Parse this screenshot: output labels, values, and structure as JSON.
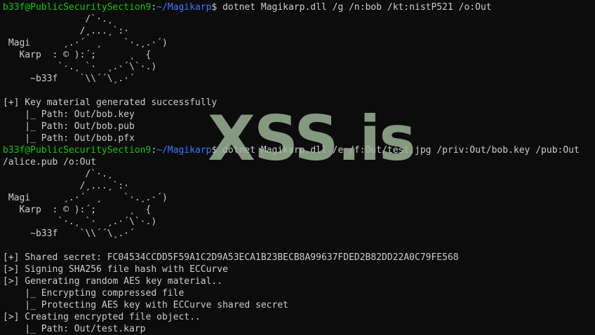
{
  "prompt": {
    "user_host": "b33f@PublicSecuritySection9",
    "separator": ":",
    "cwd": "~/Magikarp",
    "symbol": "$ "
  },
  "colors": {
    "background": "#0c0c0c",
    "text": "#cccccc",
    "user": "#16c60c",
    "path": "#3b78ff",
    "watermark": "#9fb89a"
  },
  "watermark": "XSS.is",
  "lines": [
    {
      "type": "prompt",
      "command": "dotnet Magikarp.dll /g /n:bob /kt:nistP521 /o:Out"
    },
    {
      "type": "text",
      "text": "               /`·.¸"
    },
    {
      "type": "text",
      "text": "              /¸...¸`:·"
    },
    {
      "type": "text",
      "text": " Magi      ¸.·´  ¸    `·.¸.·´)"
    },
    {
      "type": "text",
      "text": "   Karp  : © ):´;      ¸  {"
    },
    {
      "type": "text",
      "text": "          `·.¸ `·  ¸.·´\\`·.)"
    },
    {
      "type": "text",
      "text": "     ~b33f    `\\\\´´\\¸.·´"
    },
    {
      "type": "text",
      "text": ""
    },
    {
      "type": "text",
      "text": "[+] Key material generated successfully"
    },
    {
      "type": "text",
      "text": "    |_ Path: Out/bob.key"
    },
    {
      "type": "text",
      "text": "    |_ Path: Out/bob.pub"
    },
    {
      "type": "text",
      "text": "    |_ Path: Out/bob.pfx"
    },
    {
      "type": "prompt",
      "command": "dotnet Magikarp.dll /e /f:Out/test.jpg /priv:Out/bob.key /pub:Out"
    },
    {
      "type": "text",
      "text": "/alice.pub /o:Out"
    },
    {
      "type": "text",
      "text": "               /`·.¸"
    },
    {
      "type": "text",
      "text": "              /¸...¸`:·"
    },
    {
      "type": "text",
      "text": " Magi      ¸.·´  ¸    `·.¸.·´)"
    },
    {
      "type": "text",
      "text": "   Karp  : © ):´;      ¸  {"
    },
    {
      "type": "text",
      "text": "          `·.¸ `·  ¸.·´\\`·.)"
    },
    {
      "type": "text",
      "text": "     ~b33f    `\\\\´´\\¸.·´"
    },
    {
      "type": "text",
      "text": ""
    },
    {
      "type": "text",
      "text": "[+] Shared secret: FC04534CCDD5F59A1C2D9A53ECA1B23BECB8A99637FDED2B82DD22A0C79FE568"
    },
    {
      "type": "text",
      "text": "[>] Signing SHA256 file hash with ECCurve"
    },
    {
      "type": "text",
      "text": "[>] Generating random AES key material.."
    },
    {
      "type": "text",
      "text": "    |_ Encrypting compressed file"
    },
    {
      "type": "text",
      "text": "    |_ Protecting AES key with ECCurve shared secret"
    },
    {
      "type": "text",
      "text": "[>] Creating encrypted file object.."
    },
    {
      "type": "text",
      "text": "    |_ Path: Out/test.karp"
    }
  ]
}
